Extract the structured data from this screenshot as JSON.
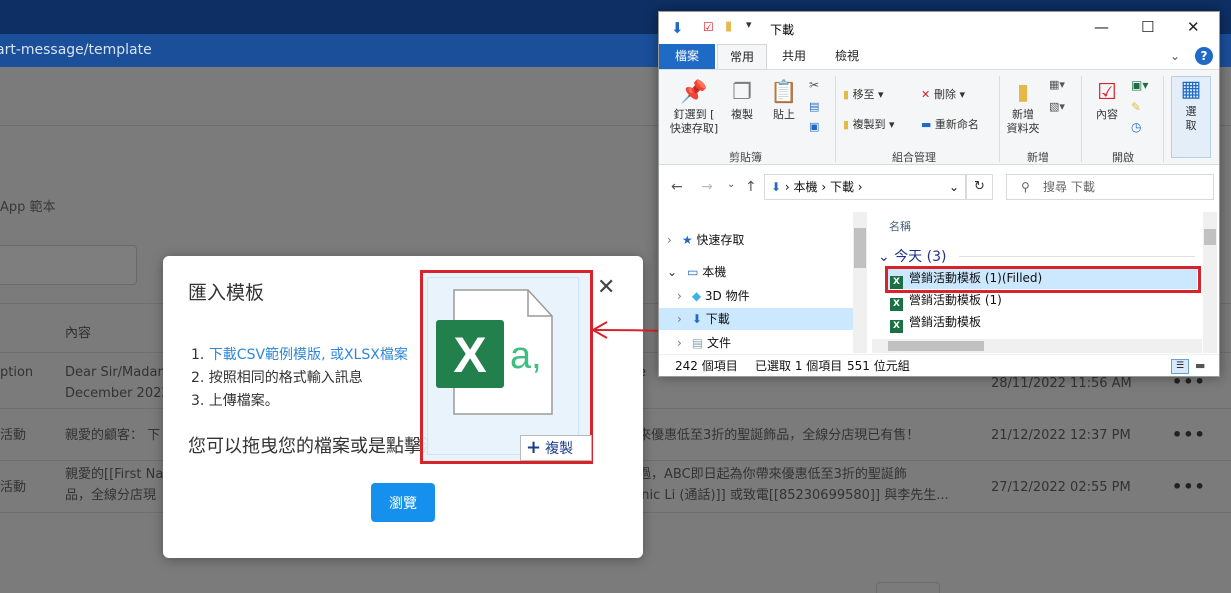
{
  "browser": {
    "url_fragment": "art-message/template"
  },
  "page": {
    "section_label": "App 範本",
    "columns": [
      "內容"
    ],
    "rows": [
      {
        "type": "ption",
        "content_lines": [
          "Dear Sir/Madam",
          "December 2022"
        ],
        "tail": "ore",
        "date": "28/11/2022 11:56 AM"
      },
      {
        "type": "活動",
        "content_lines": [
          "親愛的顧客： 下"
        ],
        "tail": "帶來優惠低至3折的聖誕飾品，全線分店現已有售！",
        "date": "21/12/2022 12:37 PM"
      },
      {
        "type": "活動",
        "content_lines": [
          "親愛的[[First Na",
          "品，全線分店現"
        ],
        "tail_lines": [
          "錯過，ABC即日起為你帶來優惠低至3折的聖誕飾",
          "minic Li (通話)]] 或致電[[85230699580]] 與李先生..."
        ],
        "date": "27/12/2022 02:55 PM"
      }
    ],
    "more_icon": "more-horizontal-icon"
  },
  "modal": {
    "title": "匯入模板",
    "steps": [
      {
        "prefix": "1. ",
        "link1": "下載CSV範例模版",
        "sep": ", ",
        "link2": "或XLSX檔案"
      },
      {
        "text": "2. 按照相同的格式輸入訊息"
      },
      {
        "text": "3. 上傳檔案。"
      }
    ],
    "drop_text": "您可以拖曳您的檔案或是點擊瀏覽檔案",
    "browse_label": "瀏覽",
    "close_icon": "close-icon"
  },
  "drag": {
    "file_icon": "excel-file-icon",
    "glyph_x": "X",
    "glyph_a": "a,",
    "copy_label": "複製",
    "copy_icon": "plus-icon"
  },
  "explorer": {
    "title": "下載",
    "tabs": [
      "檔案",
      "常用",
      "共用",
      "檢視"
    ],
    "ribbon": {
      "pin": [
        "釘選到 [",
        "快速存取]"
      ],
      "copy": "複製",
      "paste": "貼上",
      "move_to": "移至",
      "copy_to": "複製到",
      "delete": "刪除",
      "rename": "重新命名",
      "new_folder": [
        "新增",
        "資料夾"
      ],
      "properties": "內容",
      "select": [
        "選",
        "取"
      ],
      "groups": [
        "剪貼簿",
        "組合管理",
        "新增",
        "開啟"
      ]
    },
    "address": [
      "本機",
      "下載"
    ],
    "search_placeholder": "搜尋 下載",
    "nav": [
      {
        "label": "快速存取",
        "icon": "star-icon"
      },
      {
        "label": "本機",
        "icon": "computer-icon"
      },
      {
        "label": "3D 物件",
        "icon": "cube-icon"
      },
      {
        "label": "下載",
        "icon": "download-icon"
      },
      {
        "label": "文件",
        "icon": "document-icon"
      }
    ],
    "column_name": "名稱",
    "group": "今天 (3)",
    "files": [
      "營銷活動模板 (1)(Filled)",
      "營銷活動模板 (1)",
      "營銷活動模板"
    ],
    "status": {
      "count": "242 個項目",
      "selected": "已選取 1 個項目",
      "size": "551 位元組"
    }
  },
  "colors": {
    "accent": "#1590ec",
    "highlight": "#d8232a",
    "excel": "#1d7044"
  }
}
